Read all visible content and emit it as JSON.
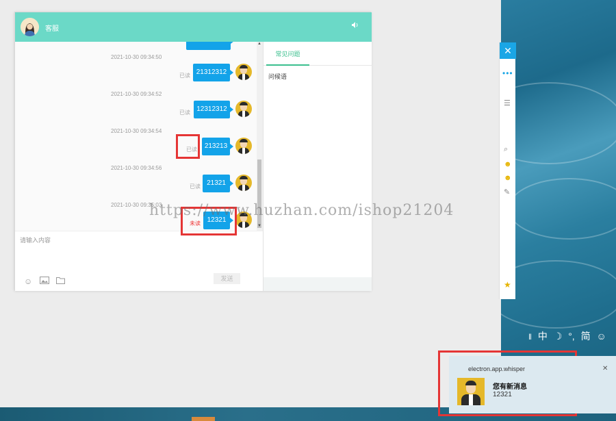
{
  "chat": {
    "title": "客服",
    "messages": [
      {
        "time": "2021-10-30 09:34:50",
        "status": "已读",
        "text": "21312312"
      },
      {
        "time": "2021-10-30 09:34:52",
        "status": "已读",
        "text": "12312312"
      },
      {
        "time": "2021-10-30 09:34:54",
        "status": "已读",
        "text": "213213"
      },
      {
        "time": "2021-10-30 09:34:56",
        "status": "已读",
        "text": "21321"
      },
      {
        "time": "2021-10-30 09:35:03",
        "status": "未读",
        "text": "12321"
      }
    ],
    "input_placeholder": "请输入内容",
    "send_label": "发送",
    "side_tab": "常见问题",
    "side_item": "问候语"
  },
  "watermark": "https://www.huzhan.com/ishop21204",
  "ime": {
    "items": [
      "中",
      "☽",
      "°,",
      "简",
      "☺"
    ]
  },
  "notification": {
    "app": "electron.app.whisper",
    "title": "您有新消息",
    "body": "12321"
  },
  "colors": {
    "header": "#6bd9c7",
    "bubble": "#13a3e9",
    "highlight": "#e53535",
    "tab_active": "#3bbf8e"
  }
}
